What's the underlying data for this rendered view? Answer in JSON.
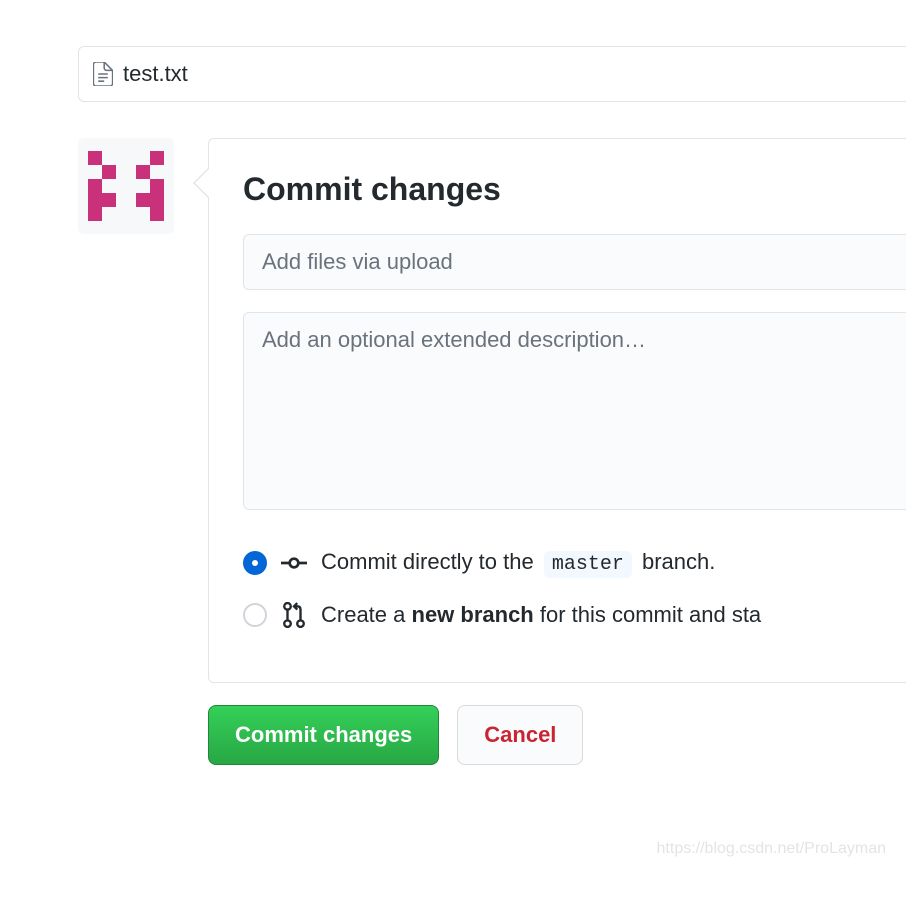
{
  "file": {
    "name": "test.txt"
  },
  "commit": {
    "heading": "Commit changes",
    "summary_placeholder": "Add files via upload",
    "description_placeholder": "Add an optional extended description…",
    "option_direct_prefix": "Commit directly to the ",
    "option_direct_branch": "master",
    "option_direct_suffix": " branch.",
    "option_new_prefix": "Create a ",
    "option_new_bold": "new branch",
    "option_new_suffix": " for this commit and sta",
    "selected_option": "direct"
  },
  "buttons": {
    "commit": "Commit changes",
    "cancel": "Cancel"
  },
  "watermark": "https://blog.csdn.net/ProLayman"
}
